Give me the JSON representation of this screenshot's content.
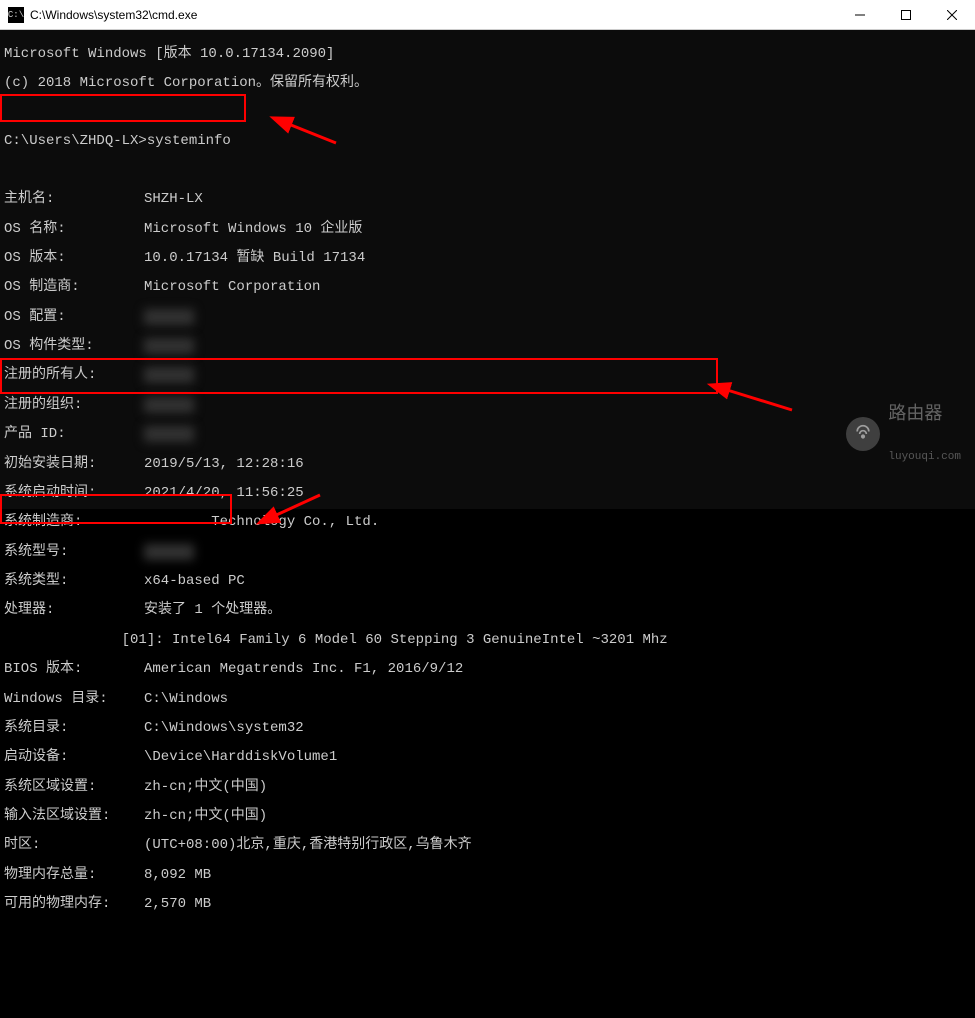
{
  "titlebar": {
    "path": "C:\\Windows\\system32\\cmd.exe"
  },
  "header": {
    "version_line": "Microsoft Windows [版本 10.0.17134.2090]",
    "copyright_line": "(c) 2018 Microsoft Corporation。保留所有权利。"
  },
  "prompt": {
    "line": "C:\\Users\\ZHDQ-LX>systeminfo"
  },
  "info": {
    "host_label": "主机名:",
    "host_val": "SHZH-LX",
    "osname_label": "OS 名称:",
    "osname_val": "Microsoft Windows 10 企业版",
    "osver_label": "OS 版本:",
    "osver_val": "10.0.17134 暂缺 Build 17134",
    "osmfr_label": "OS 制造商:",
    "osmfr_val": "Microsoft Corporation",
    "oscfg_label": "OS 配置:",
    "oscfg_val": "      ",
    "osbuild_label": "OS 构件类型:",
    "osbuild_val": "      ",
    "regowner_label": "注册的所有人:",
    "regowner_val": "      ",
    "regorg_label": "注册的组织:",
    "regorg_val": "      ",
    "prodid_label": "产品 ID:",
    "prodid_val": "      ",
    "install_label": "初始安装日期:",
    "install_val": "2019/5/13, 12:28:16",
    "boot_label": "系统启动时间:",
    "boot_val": "2021/4/20, 11:56:25",
    "sysmfr_label": "系统制造商:",
    "sysmfr_val": "        Technology Co., Ltd.",
    "sysmodel_label": "系统型号:",
    "sysmodel_val": "      ",
    "systype_label": "系统类型:",
    "systype_val": "x64-based PC",
    "cpu_label": "处理器:",
    "cpu_val": "安装了 1 个处理器。",
    "cpu_detail": "              [01]: Intel64 Family 6 Model 60 Stepping 3 GenuineIntel ~3201 Mhz",
    "bios_label": "BIOS 版本:",
    "bios_val": "American Megatrends Inc. F1, 2016/9/12",
    "windir_label": "Windows 目录:",
    "windir_val": "C:\\Windows",
    "sysdir_label": "系统目录:",
    "sysdir_val": "C:\\Windows\\system32",
    "bootdev_label": "启动设备:",
    "bootdev_val": "\\Device\\HarddiskVolume1",
    "syslocale_label": "系统区域设置:",
    "syslocale_val": "zh-cn;中文(中国)",
    "inputlocale_label": "输入法区域设置:",
    "inputlocale_val": "zh-cn;中文(中国)",
    "tz_label": "时区:",
    "tz_val": "(UTC+08:00)北京,重庆,香港特别行政区,乌鲁木齐",
    "physmem_label": "物理内存总量:",
    "physmem_val": "8,092 MB",
    "availmem_label": "可用的物理内存:",
    "availmem_val": "2,570 MB"
  },
  "watermark": {
    "title": "路由器",
    "subtitle": "luyouqi.com"
  }
}
